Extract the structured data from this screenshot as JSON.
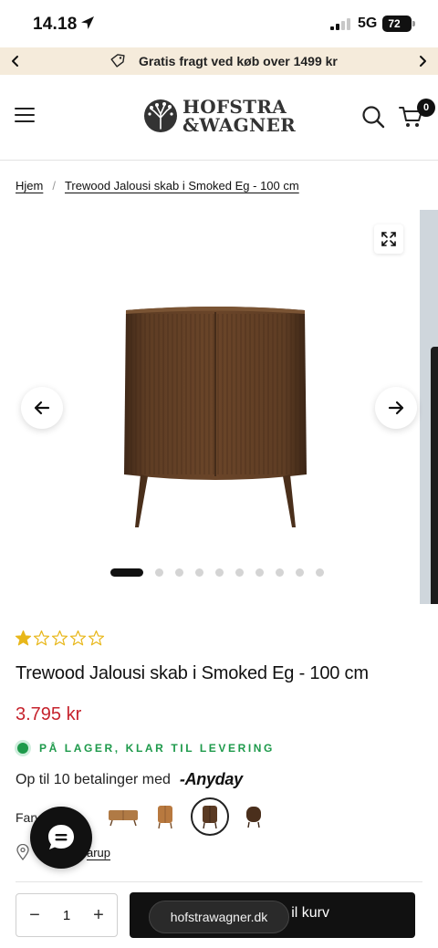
{
  "status_bar": {
    "time": "14.18",
    "network": "5G",
    "battery": "72"
  },
  "promo": {
    "text": "Gratis fragt ved køb over 1499 kr"
  },
  "header": {
    "logo_line1": "HOFSTRA",
    "logo_line2": "&WAGNER",
    "cart_count": "0"
  },
  "breadcrumb": {
    "home": "Hjem",
    "separator": "/",
    "current": "Trewood Jalousi skab i Smoked Eg - 100 cm"
  },
  "gallery": {
    "slide_count": 10,
    "active_slide": 1
  },
  "product": {
    "rating": 1,
    "rating_max": 5,
    "title": "Trewood Jalousi skab i Smoked Eg - 100 cm",
    "price": "3.795 kr",
    "stock": "PÅ LAGER, KLAR TIL LEVERING",
    "finance_text": "Op til 10 betalinger med",
    "finance_brand": "-Anyday",
    "color_label": "Farve",
    "store_text": "arup"
  },
  "swatches": [
    {
      "name": "oak-sideboard",
      "selected": false
    },
    {
      "name": "natural-cabinet",
      "selected": false
    },
    {
      "name": "smoked-cabinet",
      "selected": true
    },
    {
      "name": "dark-round-cabinet",
      "selected": false
    }
  ],
  "cart": {
    "quantity": "1",
    "minus": "−",
    "plus": "+",
    "add_label": "il kurv"
  },
  "browser": {
    "url": "hofstrawagner.dk"
  },
  "colors": {
    "promo_bg": "#f5ebdb",
    "price": "#c6232d",
    "stock": "#1e9a4b",
    "star": "#e8b71a",
    "wood": "#5a3a23"
  }
}
